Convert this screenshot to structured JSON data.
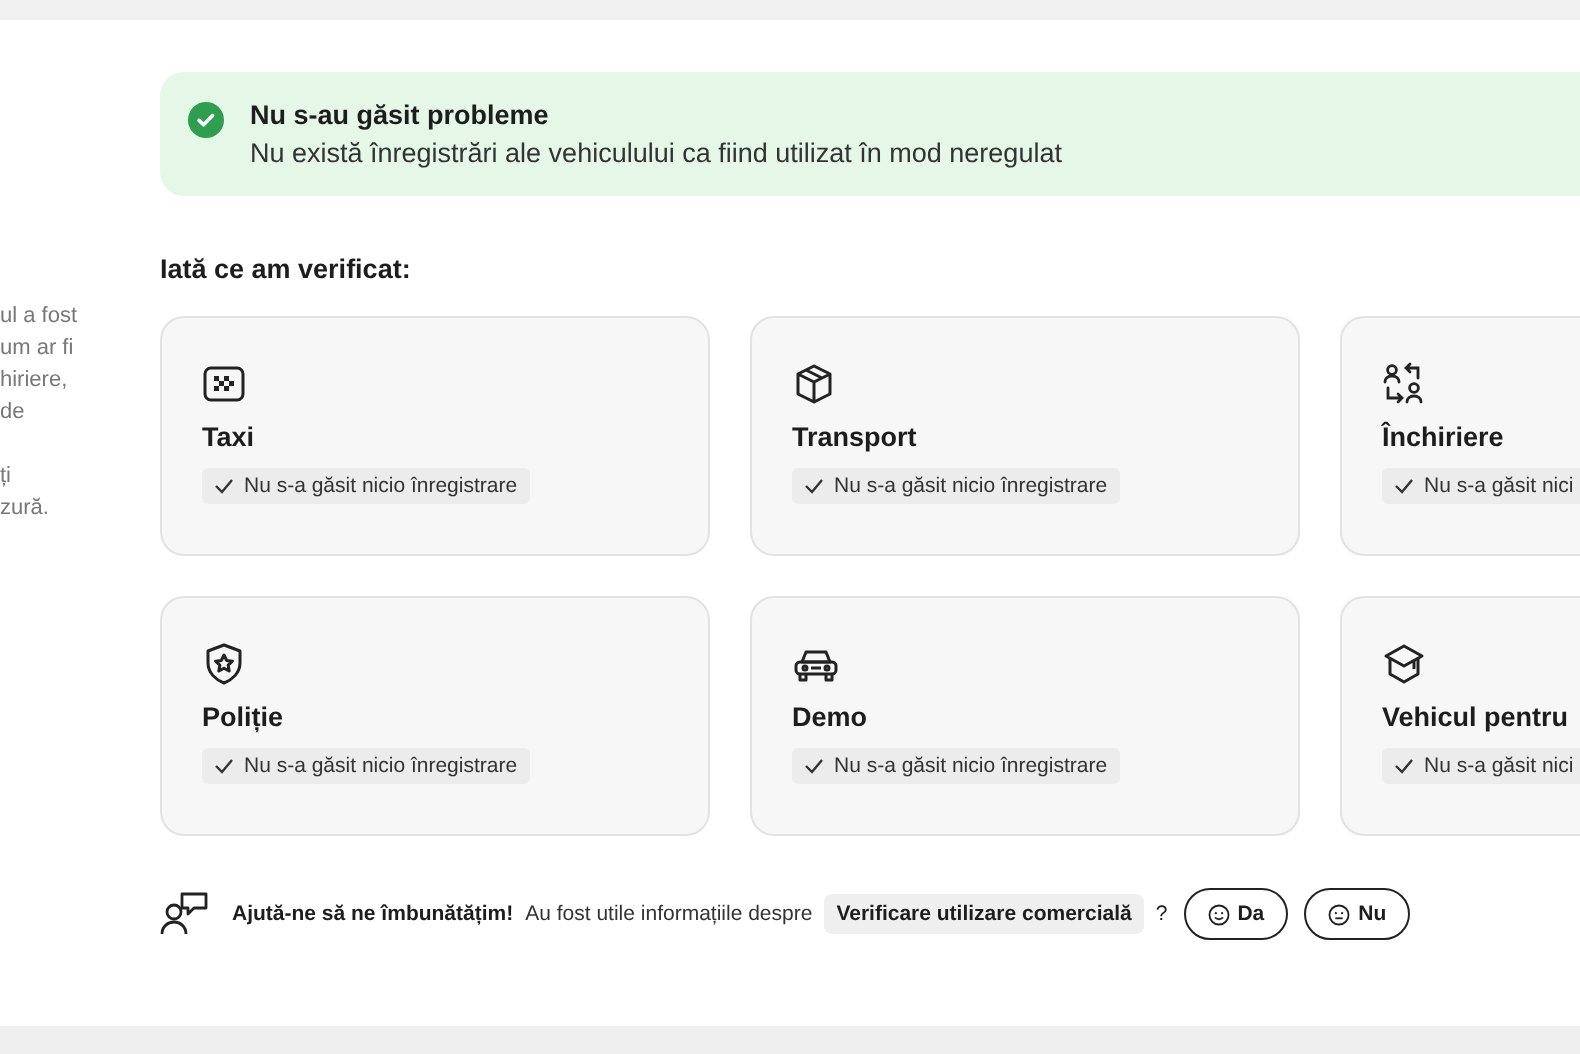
{
  "sidebar_text": [
    [
      "ul a fost",
      "um ar fi",
      "hiriere,",
      "de"
    ],
    [
      "ți",
      "zură."
    ]
  ],
  "result": {
    "title": "Nu s-au găsit probleme",
    "message": "Nu există înregistrări ale vehiculului ca fiind utilizat în mod neregulat"
  },
  "checks_heading": "Iată ce am verificat:",
  "checks": [
    {
      "kind": "taxi",
      "title": "Taxi",
      "status": "Nu s-a găsit nicio înregistrare"
    },
    {
      "kind": "transport",
      "title": "Transport",
      "status": "Nu s-a găsit nicio înregistrare"
    },
    {
      "kind": "rental",
      "title": "Închiriere",
      "status": "Nu s-a găsit nici"
    },
    {
      "kind": "police",
      "title": "Poliție",
      "status": "Nu s-a găsit nicio înregistrare"
    },
    {
      "kind": "demo",
      "title": "Demo",
      "status": "Nu s-a găsit nicio înregistrare"
    },
    {
      "kind": "school",
      "title": "Vehicul pentru",
      "status": "Nu s-a găsit nici"
    }
  ],
  "feedback": {
    "prompt": "Ajută-ne să ne îmbunătățim!",
    "question": "Au fost utile informațiile despre",
    "topic": "Verificare utilizare comercială",
    "question_mark": "?",
    "buttons": [
      {
        "kind": "happy",
        "label": "Da"
      },
      {
        "kind": "neutral",
        "label": "Nu"
      }
    ]
  }
}
